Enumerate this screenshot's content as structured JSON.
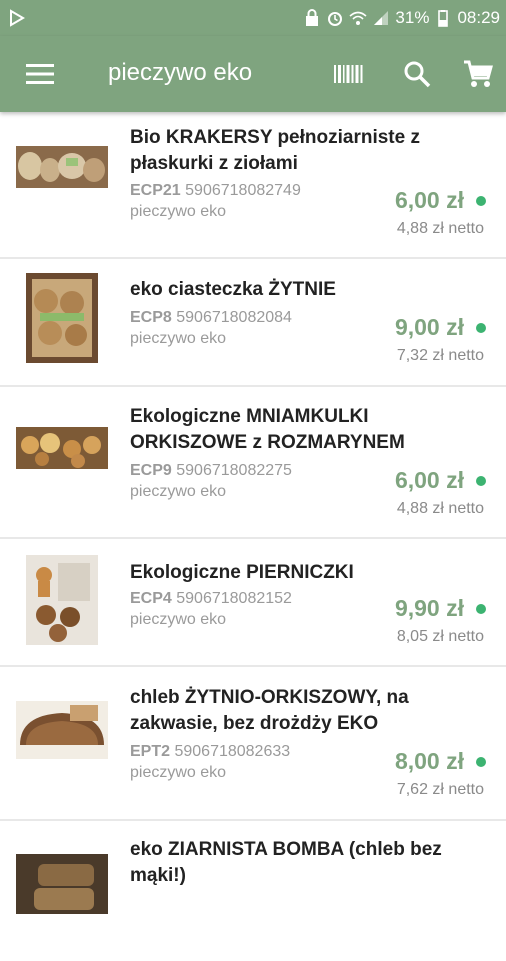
{
  "status_bar": {
    "battery": "31%",
    "time": "08:29"
  },
  "toolbar": {
    "title": "pieczywo eko",
    "icons": [
      "menu-icon",
      "barcode-icon",
      "search-icon",
      "cart-icon"
    ]
  },
  "colors": {
    "accent": "#7fa47f",
    "available": "#3cb371"
  },
  "products": [
    {
      "name": "Bio KRAKERSY pełnoziarniste z płaskurki z ziołami",
      "code": "ECP21",
      "ean": "5906718082749",
      "category": "pieczywo eko",
      "price": "6,00 zł",
      "netto": "4,88 zł netto"
    },
    {
      "name": "eko ciasteczka ŻYTNIE",
      "code": "ECP8",
      "ean": "5906718082084",
      "category": "pieczywo eko",
      "price": "9,00 zł",
      "netto": "7,32 zł netto"
    },
    {
      "name": "Ekologiczne MNIAMKULKI ORKISZOWE z ROZMARYNEM",
      "code": "ECP9",
      "ean": "5906718082275",
      "category": "pieczywo eko",
      "price": "6,00 zł",
      "netto": "4,88 zł netto"
    },
    {
      "name": "Ekologiczne PIERNICZKI",
      "code": "ECP4",
      "ean": "5906718082152",
      "category": "pieczywo eko",
      "price": "9,90 zł",
      "netto": "8,05 zł netto"
    },
    {
      "name": "chleb ŻYTNIO-ORKISZOWY, na zakwasie, bez drożdży EKO",
      "code": "EPT2",
      "ean": "5906718082633",
      "category": "pieczywo eko",
      "price": "8,00 zł",
      "netto": "7,62 zł netto"
    },
    {
      "name": "eko ZIARNISTA BOMBA (chleb bez mąki!)"
    }
  ]
}
